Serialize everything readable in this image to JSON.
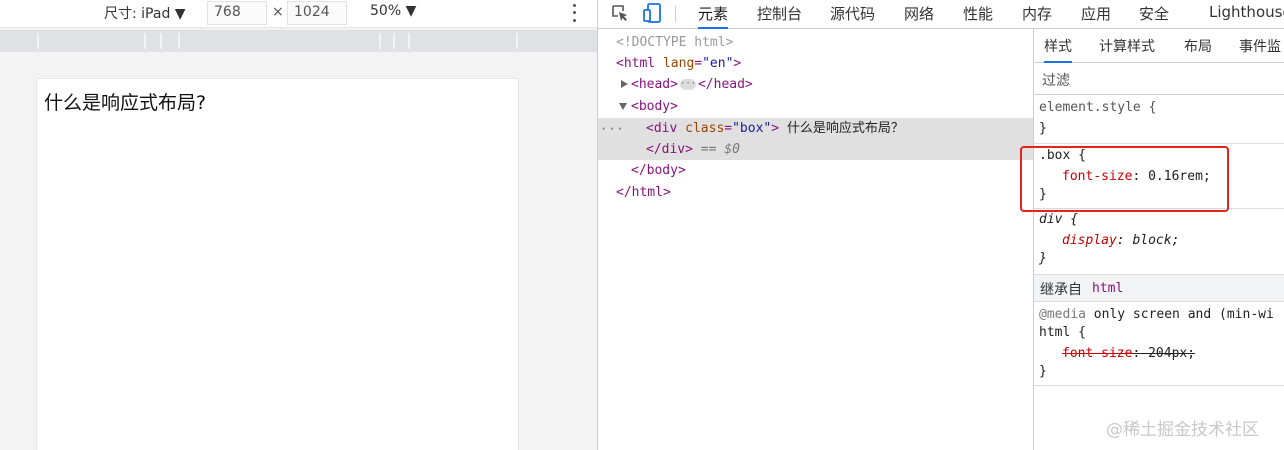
{
  "device_toolbar": {
    "device": "尺寸: iPad ▼",
    "width": "768",
    "times": "×",
    "height": "1024",
    "zoom": "50% ▼"
  },
  "page": {
    "text": "什么是响应式布局?"
  },
  "devtools": {
    "tabs": [
      "元素",
      "控制台",
      "源代码",
      "网络",
      "性能",
      "内存",
      "应用",
      "安全",
      "Lighthouse"
    ],
    "active_tab": "元素"
  },
  "elements": {
    "doctype": "<!DOCTYPE html>",
    "html_open_tag": "<html",
    "html_attr_name": "lang",
    "html_attr_eq": "=",
    "html_attr_val": "\"en\"",
    "html_open_end": ">",
    "head_open": "<head>",
    "head_ellipsis": "···",
    "head_close": "</head>",
    "body_open": "<body>",
    "div_open_tag": "<div",
    "div_attr_name": "class",
    "div_attr_eq": "=",
    "div_attr_val": "\"box\"",
    "div_open_end": ">",
    "div_text": "什么是响应式布局？",
    "div_close": "</div>",
    "eq0": "== $0",
    "body_close": "</body>",
    "html_close": "</html>",
    "row_ellipsis": "···"
  },
  "styles": {
    "tabs": [
      "样式",
      "计算样式",
      "布局",
      "事件监"
    ],
    "active_tab": "样式",
    "filter_label": "过滤",
    "element_style_selector": "element.style {",
    "close_brace": "}",
    "box_selector": ".box {",
    "box_prop": "font-size",
    "box_colon": ":",
    "box_val": "0.16rem;",
    "div_selector": "div {",
    "div_prop": "display",
    "div_val": "block;",
    "inherited_label": "继承自",
    "inherited_from": "html",
    "media_at": "@media",
    "media_query": " only screen and (min-wi",
    "html_selector": "html {",
    "html_prop": "font-size",
    "html_val": "204px;"
  },
  "watermark": "@稀土掘金技术社区",
  "colors": {
    "accent": "#1a73e8",
    "highlight": "#e5241f",
    "tag": "#881280",
    "property": "#c80000"
  }
}
